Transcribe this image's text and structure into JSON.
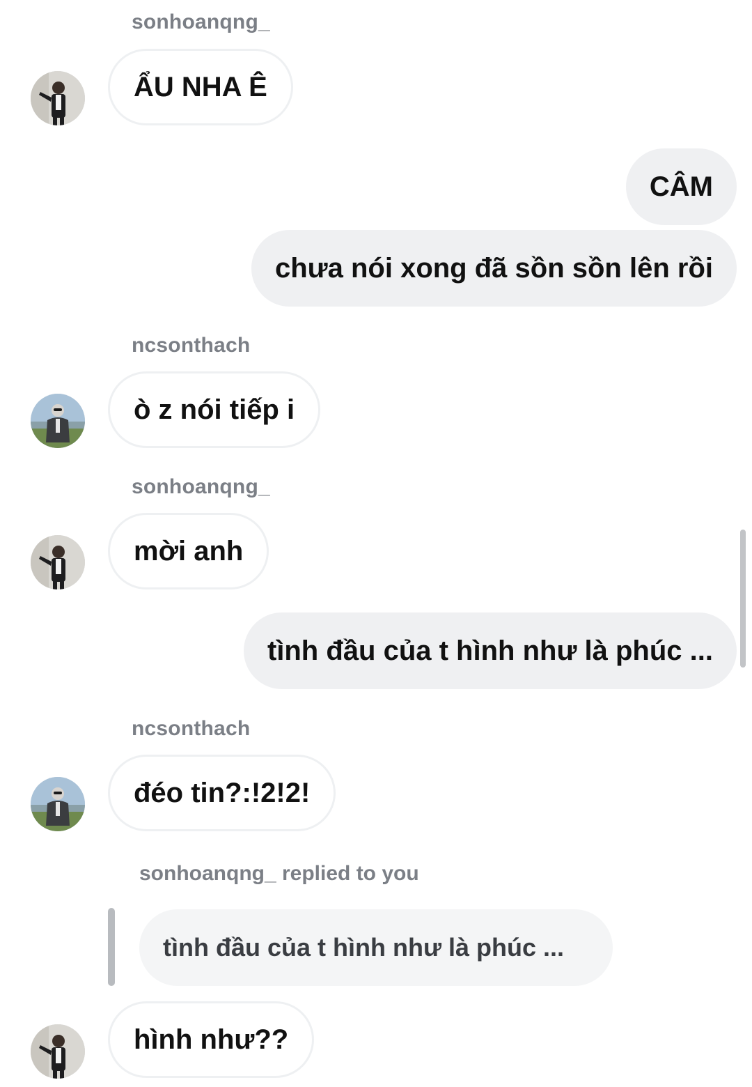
{
  "messages": [
    {
      "sender": "sonhoanqng_",
      "text": "ẨU NHA Ê",
      "direction": "incoming",
      "avatar": "avatar-sonhoanqng"
    },
    {
      "text": "CÂM",
      "direction": "outgoing"
    },
    {
      "text": "chưa nói xong đã sồn sồn lên rồi",
      "direction": "outgoing"
    },
    {
      "sender": "ncsonthach",
      "text": "ò z nói tiếp i",
      "direction": "incoming",
      "avatar": "avatar-ncsonthach"
    },
    {
      "sender": "sonhoanqng_",
      "text": "mời anh",
      "direction": "incoming",
      "avatar": "avatar-sonhoanqng"
    },
    {
      "text": "tình đầu của t hình như là phúc ...",
      "direction": "outgoing"
    },
    {
      "sender": "ncsonthach",
      "text": "đéo tin?:!2!2!",
      "direction": "incoming",
      "avatar": "avatar-ncsonthach"
    },
    {
      "reply_label": "sonhoanqng_ replied to you",
      "quoted_text": "tình đầu của t hình như là phúc ...",
      "text": "hình như??",
      "direction": "incoming",
      "avatar": "avatar-sonhoanqng"
    }
  ],
  "colors": {
    "outgoing_bubble": "#eff0f2",
    "incoming_border": "#eef0f2",
    "sender_label": "#7b7f86",
    "reply_bar": "#b8bbbf"
  }
}
